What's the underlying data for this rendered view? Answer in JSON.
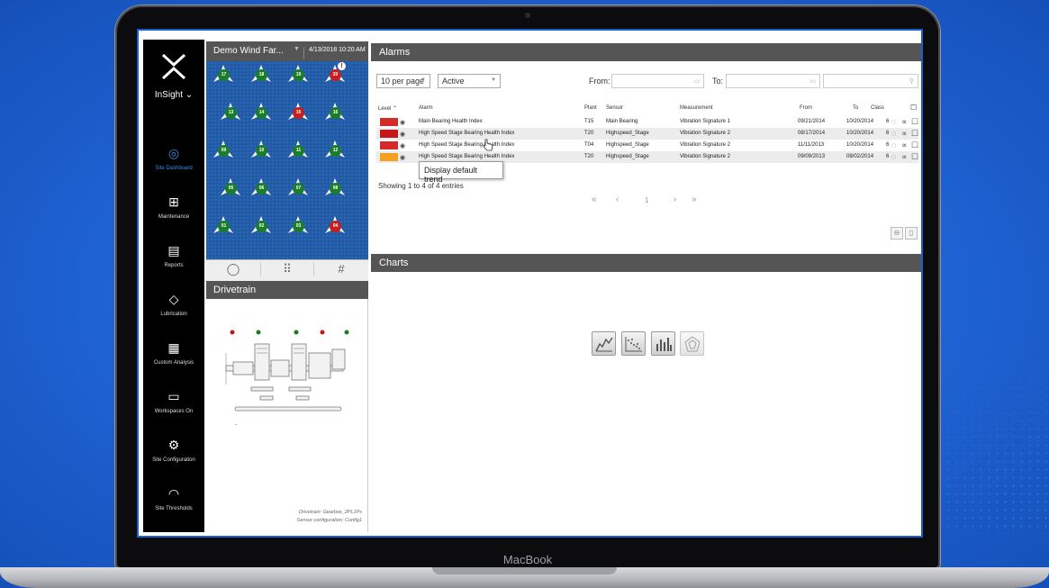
{
  "device": {
    "brand_label": "MacBook"
  },
  "nav": {
    "app_name": "InSight ⌄",
    "items": [
      {
        "label": "Site Dashboard",
        "icon": "dashboard-icon",
        "active": true
      },
      {
        "label": "Maintenance",
        "icon": "maintenance-icon"
      },
      {
        "label": "Reports",
        "icon": "reports-icon"
      },
      {
        "label": "Lubrication",
        "icon": "lubrication-icon"
      },
      {
        "label": "Custom Analysis",
        "icon": "calculator-icon"
      },
      {
        "label": "Workspaces On",
        "icon": "workspace-icon"
      },
      {
        "label": "Site Configuration",
        "icon": "gear-icon"
      },
      {
        "label": "Site Thresholds",
        "icon": "threshold-icon"
      }
    ]
  },
  "site": {
    "name": "Demo Wind Far...",
    "datetime": "4/13/2018 10:20 AM",
    "turbines": [
      {
        "id": "17",
        "status": "green"
      },
      {
        "id": "18",
        "status": "green"
      },
      {
        "id": "19",
        "status": "green"
      },
      {
        "id": "20",
        "status": "red",
        "alert": true
      },
      {
        "id": "13",
        "status": "green"
      },
      {
        "id": "14",
        "status": "green"
      },
      {
        "id": "15",
        "status": "red"
      },
      {
        "id": "16",
        "status": "green"
      },
      {
        "id": "09",
        "status": "green"
      },
      {
        "id": "10",
        "status": "green"
      },
      {
        "id": "11",
        "status": "green"
      },
      {
        "id": "12",
        "status": "green"
      },
      {
        "id": "05",
        "status": "green"
      },
      {
        "id": "06",
        "status": "green"
      },
      {
        "id": "07",
        "status": "green"
      },
      {
        "id": "08",
        "status": "green"
      },
      {
        "id": "01",
        "status": "green"
      },
      {
        "id": "02",
        "status": "green"
      },
      {
        "id": "03",
        "status": "green"
      },
      {
        "id": "04",
        "status": "red"
      }
    ],
    "alert_glyph": "!",
    "view_buttons": [
      "◯",
      "⠿",
      "#"
    ]
  },
  "drivetrain": {
    "title": "Drivetrain",
    "caption_line1": "Drivetrain: Gearbox_2PL1Ps",
    "caption_line2": "Sensor configuration: Config1"
  },
  "alarms": {
    "title": "Alarms",
    "per_page": "10 per page",
    "filter": "Active",
    "from_label": "From:",
    "to_label": "To:",
    "calendar_glyph": "▭",
    "search_glyph": "⚲",
    "columns": {
      "level": "Level ⌃",
      "alarm": "Alarm",
      "plant": "Plant",
      "sensor": "Sensor",
      "measurement": "Measurement",
      "from": "From",
      "to": "To",
      "class": "Class"
    },
    "rows": [
      {
        "level_color": "#d42a2a",
        "alarm": "Main Bearing Health Index",
        "plant": "T15",
        "sensor": "Main Bearing",
        "measurement": "Vibration Signature 1",
        "from": "09/21/2014",
        "to": "10/20/2014",
        "class": "6"
      },
      {
        "level_color": "#c41818",
        "alarm": "High Speed Stage Bearing Health Index",
        "plant": "T20",
        "sensor": "Highspeed_Stage",
        "measurement": "Vibration Signature 2",
        "from": "08/17/2014",
        "to": "10/20/2014",
        "class": "6"
      },
      {
        "level_color": "#d42a2a",
        "alarm": "High Speed Stage Bearing Health Index",
        "plant": "T04",
        "sensor": "Highspeed_Stage",
        "measurement": "Vibration Signature 2",
        "from": "11/11/2013",
        "to": "10/20/2014",
        "class": "6"
      },
      {
        "level_color": "#f5a020",
        "alarm": "High Speed Stage Bearing Health Index",
        "plant": "T20",
        "sensor": "Highspeed_Stage",
        "measurement": "Vibration Signature 2",
        "from": "09/09/2013",
        "to": "08/02/2014",
        "class": "6"
      }
    ],
    "showing": "Showing 1 to 4 of 4 entries",
    "pagination": {
      "first": "«",
      "prev": "‹",
      "page": "1",
      "next": "›",
      "last": "»"
    },
    "tooltip": "Display default trend",
    "row_icons": {
      "eye": "◉",
      "comment": "◌",
      "share": "∝",
      "check": "☐"
    },
    "action_icons": {
      "link": "⊖",
      "delete": "▯"
    }
  },
  "charts": {
    "title": "Charts",
    "buttons": [
      "line-chart-icon",
      "scatter-chart-icon",
      "bar-chart-icon",
      "radar-chart-icon"
    ]
  }
}
